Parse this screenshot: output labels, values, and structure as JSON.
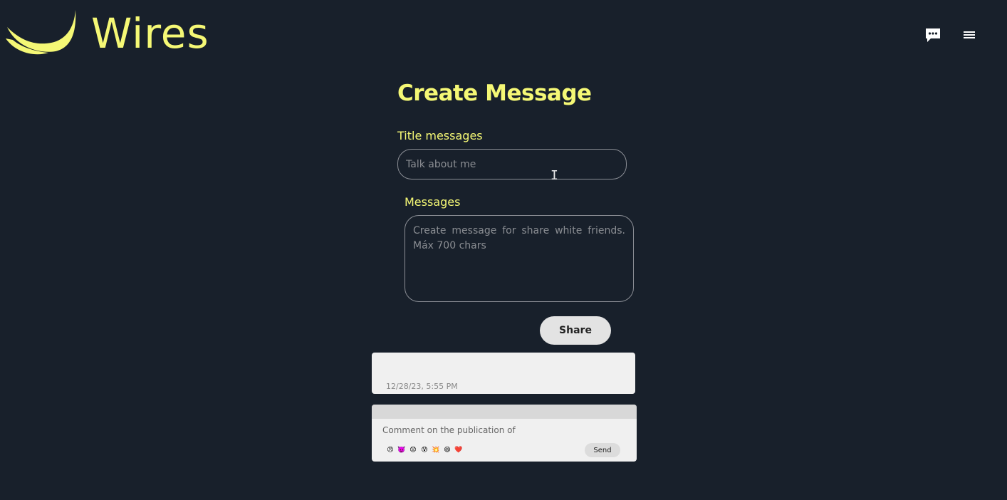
{
  "brand": {
    "name": "Wires",
    "accent": "#f5f875",
    "background": "#18202b"
  },
  "header": {
    "chat_icon": "chat-bubble-icon",
    "menu_icon": "hamburger-menu-icon"
  },
  "form": {
    "title": "Create Message",
    "title_label": "Title messages",
    "title_placeholder": "Talk about me",
    "message_label": "Messages",
    "message_placeholder": "Create message for share white friends. Máx 700 chars",
    "share_label": "Share"
  },
  "post": {
    "date": "12/28/23, 5:55 PM"
  },
  "comment": {
    "label": "Comment on the publication of",
    "reactions": [
      "😠",
      "👿",
      "😟",
      "😰",
      "💥",
      "😄",
      "❤️"
    ],
    "send_label": "Send"
  }
}
